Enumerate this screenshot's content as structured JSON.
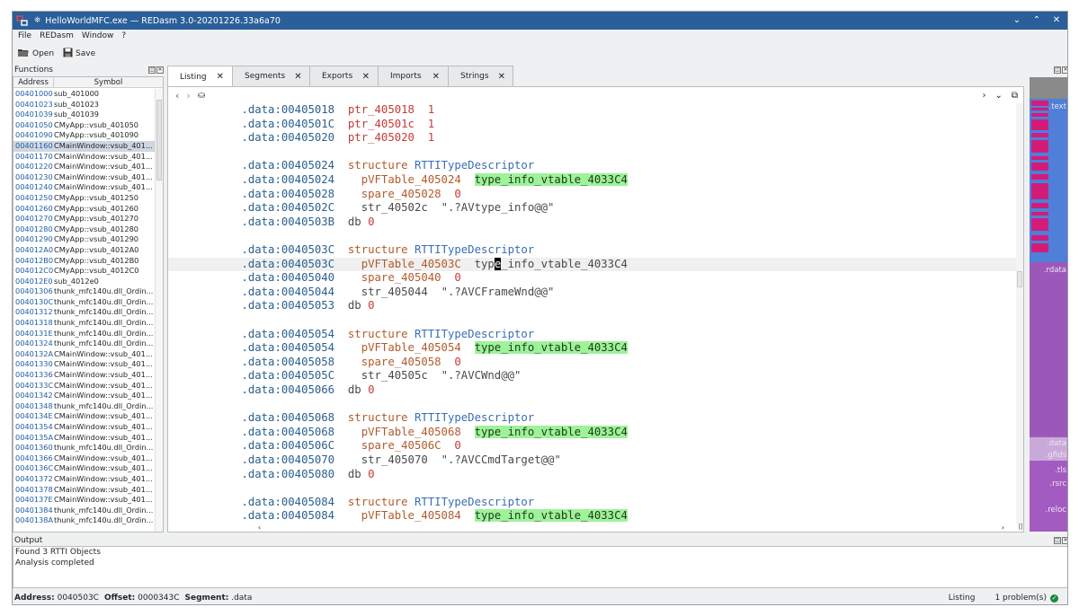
{
  "window": {
    "title": "HelloWorldMFC.exe — REDasm 3.0-20201226.33a6a70",
    "controls": [
      "⌄",
      "⌃",
      "✕"
    ]
  },
  "menu": [
    "File",
    "REDasm",
    "Window",
    "?"
  ],
  "toolbar": {
    "open_label": "Open",
    "save_label": "Save"
  },
  "functions": {
    "title": "Functions",
    "col_address": "Address",
    "col_symbol": "Symbol",
    "rows": [
      {
        "address": "00401000",
        "symbol": "sub_401000"
      },
      {
        "address": "00401023",
        "symbol": "sub_401023"
      },
      {
        "address": "00401039",
        "symbol": "sub_401039"
      },
      {
        "address": "00401050",
        "symbol": "CMyApp::vsub_401050"
      },
      {
        "address": "00401090",
        "symbol": "CMyApp::vsub_401090"
      },
      {
        "address": "00401160",
        "symbol": "CMainWindow::vsub_401..."
      },
      {
        "address": "00401170",
        "symbol": "CMainWindow::vsub_401..."
      },
      {
        "address": "00401220",
        "symbol": "CMainWindow::vsub_401..."
      },
      {
        "address": "00401230",
        "symbol": "CMainWindow::vsub_401..."
      },
      {
        "address": "00401240",
        "symbol": "CMainWindow::vsub_401..."
      },
      {
        "address": "00401250",
        "symbol": "CMyApp::vsub_401250"
      },
      {
        "address": "00401260",
        "symbol": "CMyApp::vsub_401260"
      },
      {
        "address": "00401270",
        "symbol": "CMyApp::vsub_401270"
      },
      {
        "address": "00401280",
        "symbol": "CMyApp::vsub_401280"
      },
      {
        "address": "00401290",
        "symbol": "CMyApp::vsub_401290"
      },
      {
        "address": "004012A0",
        "symbol": "CMyApp::vsub_4012A0"
      },
      {
        "address": "004012B0",
        "symbol": "CMyApp::vsub_4012B0"
      },
      {
        "address": "004012C0",
        "symbol": "CMyApp::vsub_4012C0"
      },
      {
        "address": "004012E0",
        "symbol": "sub_4012e0"
      },
      {
        "address": "00401306",
        "symbol": "thunk_mfc140u.dll_Ordin..."
      },
      {
        "address": "0040130C",
        "symbol": "thunk_mfc140u.dll_Ordin..."
      },
      {
        "address": "00401312",
        "symbol": "thunk_mfc140u.dll_Ordin..."
      },
      {
        "address": "00401318",
        "symbol": "thunk_mfc140u.dll_Ordin..."
      },
      {
        "address": "0040131E",
        "symbol": "thunk_mfc140u.dll_Ordin..."
      },
      {
        "address": "00401324",
        "symbol": "thunk_mfc140u.dll_Ordin..."
      },
      {
        "address": "0040132A",
        "symbol": "CMainWindow::vsub_401..."
      },
      {
        "address": "00401330",
        "symbol": "CMainWindow::vsub_401..."
      },
      {
        "address": "00401336",
        "symbol": "CMainWindow::vsub_401..."
      },
      {
        "address": "0040133C",
        "symbol": "CMainWindow::vsub_401..."
      },
      {
        "address": "00401342",
        "symbol": "CMainWindow::vsub_401..."
      },
      {
        "address": "00401348",
        "symbol": "thunk_mfc140u.dll_Ordin..."
      },
      {
        "address": "0040134E",
        "symbol": "CMainWindow::vsub_401..."
      },
      {
        "address": "00401354",
        "symbol": "CMainWindow::vsub_401..."
      },
      {
        "address": "0040135A",
        "symbol": "CMainWindow::vsub_401..."
      },
      {
        "address": "00401360",
        "symbol": "thunk_mfc140u.dll_Ordin..."
      },
      {
        "address": "00401366",
        "symbol": "CMainWindow::vsub_401..."
      },
      {
        "address": "0040136C",
        "symbol": "CMainWindow::vsub_401..."
      },
      {
        "address": "00401372",
        "symbol": "CMainWindow::vsub_401..."
      },
      {
        "address": "00401378",
        "symbol": "CMainWindow::vsub_401..."
      },
      {
        "address": "0040137E",
        "symbol": "CMainWindow::vsub_401..."
      },
      {
        "address": "00401384",
        "symbol": "thunk_mfc140u.dll_Ordin..."
      },
      {
        "address": "0040138A",
        "symbol": "thunk_mfc140u.dll_Ordin..."
      }
    ],
    "selected_index": 5
  },
  "tabs": [
    {
      "label": "Listing",
      "active": true
    },
    {
      "label": "Segments",
      "active": false
    },
    {
      "label": "Exports",
      "active": false
    },
    {
      "label": "Imports",
      "active": false
    },
    {
      "label": "Strings",
      "active": false
    }
  ],
  "listing": [
    {
      "seg": ".data:00405018",
      "parts": [
        [
          "name",
          "ptr_405018"
        ],
        [
          "txt",
          "  "
        ],
        [
          "num",
          "1"
        ]
      ]
    },
    {
      "seg": ".data:0040501C",
      "parts": [
        [
          "name",
          "ptr_40501c"
        ],
        [
          "txt",
          "  "
        ],
        [
          "num",
          "1"
        ]
      ]
    },
    {
      "seg": ".data:00405020",
      "parts": [
        [
          "name",
          "ptr_405020"
        ],
        [
          "txt",
          "  "
        ],
        [
          "num",
          "1"
        ]
      ]
    },
    {
      "seg": "",
      "parts": []
    },
    {
      "seg": ".data:00405024",
      "parts": [
        [
          "kw",
          "structure"
        ],
        [
          "txt",
          " "
        ],
        [
          "type",
          "RTTITypeDescriptor"
        ]
      ]
    },
    {
      "seg": ".data:00405024",
      "parts": [
        [
          "txt",
          "  "
        ],
        [
          "kw",
          "pVFTable_405024"
        ],
        [
          "txt",
          "  "
        ],
        [
          "hl",
          "type_info_vtable_4033C4"
        ]
      ]
    },
    {
      "seg": ".data:00405028",
      "parts": [
        [
          "txt",
          "  "
        ],
        [
          "kw",
          "spare_405028"
        ],
        [
          "txt",
          "  "
        ],
        [
          "num",
          "0"
        ]
      ]
    },
    {
      "seg": ".data:0040502C",
      "parts": [
        [
          "txt",
          "  "
        ],
        [
          "db",
          "str_40502c"
        ],
        [
          "txt",
          "  "
        ],
        [
          "str",
          "\".?AVtype_info@@\""
        ]
      ]
    },
    {
      "seg": ".data:0040503B",
      "parts": [
        [
          "db",
          "db"
        ],
        [
          "txt",
          " "
        ],
        [
          "num",
          "0"
        ]
      ]
    },
    {
      "seg": "",
      "parts": []
    },
    {
      "seg": ".data:0040503C",
      "parts": [
        [
          "kw",
          "structure"
        ],
        [
          "txt",
          " "
        ],
        [
          "type",
          "RTTITypeDescriptor"
        ]
      ]
    },
    {
      "seg": ".data:0040503C",
      "cur": true,
      "parts": [
        [
          "txt",
          "  "
        ],
        [
          "kw",
          "pVFTable_40503C"
        ],
        [
          "txt",
          "  "
        ],
        [
          "db",
          "typ"
        ],
        [
          "cur",
          "e"
        ],
        [
          "db",
          "_info_vtable_4033C4"
        ]
      ]
    },
    {
      "seg": ".data:00405040",
      "parts": [
        [
          "txt",
          "  "
        ],
        [
          "kw",
          "spare_405040"
        ],
        [
          "txt",
          "  "
        ],
        [
          "num",
          "0"
        ]
      ]
    },
    {
      "seg": ".data:00405044",
      "parts": [
        [
          "txt",
          "  "
        ],
        [
          "db",
          "str_405044"
        ],
        [
          "txt",
          "  "
        ],
        [
          "str",
          "\".?AVCFrameWnd@@\""
        ]
      ]
    },
    {
      "seg": ".data:00405053",
      "parts": [
        [
          "db",
          "db"
        ],
        [
          "txt",
          " "
        ],
        [
          "num",
          "0"
        ]
      ]
    },
    {
      "seg": "",
      "parts": []
    },
    {
      "seg": ".data:00405054",
      "parts": [
        [
          "kw",
          "structure"
        ],
        [
          "txt",
          " "
        ],
        [
          "type",
          "RTTITypeDescriptor"
        ]
      ]
    },
    {
      "seg": ".data:00405054",
      "parts": [
        [
          "txt",
          "  "
        ],
        [
          "kw",
          "pVFTable_405054"
        ],
        [
          "txt",
          "  "
        ],
        [
          "hl",
          "type_info_vtable_4033C4"
        ]
      ]
    },
    {
      "seg": ".data:00405058",
      "parts": [
        [
          "txt",
          "  "
        ],
        [
          "kw",
          "spare_405058"
        ],
        [
          "txt",
          "  "
        ],
        [
          "num",
          "0"
        ]
      ]
    },
    {
      "seg": ".data:0040505C",
      "parts": [
        [
          "txt",
          "  "
        ],
        [
          "db",
          "str_40505c"
        ],
        [
          "txt",
          "  "
        ],
        [
          "str",
          "\".?AVCWnd@@\""
        ]
      ]
    },
    {
      "seg": ".data:00405066",
      "parts": [
        [
          "db",
          "db"
        ],
        [
          "txt",
          " "
        ],
        [
          "num",
          "0"
        ]
      ]
    },
    {
      "seg": "",
      "parts": []
    },
    {
      "seg": ".data:00405068",
      "parts": [
        [
          "kw",
          "structure"
        ],
        [
          "txt",
          " "
        ],
        [
          "type",
          "RTTITypeDescriptor"
        ]
      ]
    },
    {
      "seg": ".data:00405068",
      "parts": [
        [
          "txt",
          "  "
        ],
        [
          "kw",
          "pVFTable_405068"
        ],
        [
          "txt",
          "  "
        ],
        [
          "hl",
          "type_info_vtable_4033C4"
        ]
      ]
    },
    {
      "seg": ".data:0040506C",
      "parts": [
        [
          "txt",
          "  "
        ],
        [
          "kw",
          "spare_40506C"
        ],
        [
          "txt",
          "  "
        ],
        [
          "num",
          "0"
        ]
      ]
    },
    {
      "seg": ".data:00405070",
      "parts": [
        [
          "txt",
          "  "
        ],
        [
          "db",
          "str_405070"
        ],
        [
          "txt",
          "  "
        ],
        [
          "str",
          "\".?AVCCmdTarget@@\""
        ]
      ]
    },
    {
      "seg": ".data:00405080",
      "parts": [
        [
          "db",
          "db"
        ],
        [
          "txt",
          " "
        ],
        [
          "num",
          "0"
        ]
      ]
    },
    {
      "seg": "",
      "parts": []
    },
    {
      "seg": ".data:00405084",
      "parts": [
        [
          "kw",
          "structure"
        ],
        [
          "txt",
          " "
        ],
        [
          "type",
          "RTTITypeDescriptor"
        ]
      ]
    },
    {
      "seg": ".data:00405084",
      "parts": [
        [
          "txt",
          "  "
        ],
        [
          "kw",
          "pVFTable_405084"
        ],
        [
          "txt",
          "  "
        ],
        [
          "hl",
          "type_info_vtable_4033C4"
        ]
      ]
    }
  ],
  "map": {
    "labels": [
      ".text",
      ".rdata",
      ".data",
      ".gfids",
      ".tls",
      ".rsrc",
      ".reloc"
    ]
  },
  "output": {
    "title": "Output",
    "lines": [
      "Found 3 RTTI Objects",
      "Analysis completed"
    ]
  },
  "status": {
    "address_label": "Address:",
    "address_value": "0040503C",
    "offset_label": "Offset:",
    "offset_value": "0000343C",
    "segment_label": "Segment:",
    "segment_value": ".data",
    "view": "Listing",
    "problems": "1 problem(s)"
  },
  "colors": {
    "titlebar": "#2a5f9a",
    "text_segment": "#4f7fd8",
    "rdata_segment": "#9b58b8",
    "code_blocks": "#d11d79",
    "highlight": "#9ef29a"
  }
}
